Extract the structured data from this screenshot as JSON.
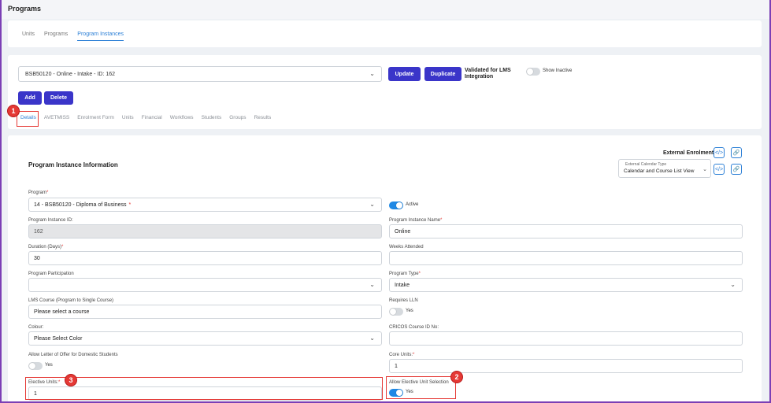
{
  "header": {
    "title": "Programs"
  },
  "subnav": [
    {
      "label": "Units",
      "active": false
    },
    {
      "label": "Programs",
      "active": false
    },
    {
      "label": "Program Instances",
      "active": true
    }
  ],
  "instance_select": {
    "value": "BSB50120 - Online - Intake - ID: 162"
  },
  "toolbar": {
    "update_label": "Update",
    "duplicate_label": "Duplicate",
    "validated_label": "Validated for LMS Integration",
    "show_inactive_label": "Show Inactive",
    "add_label": "Add",
    "delete_label": "Delete"
  },
  "tabs": [
    {
      "label": "Details",
      "active": true
    },
    {
      "label": "AVETMISS",
      "active": false
    },
    {
      "label": "Enrolment Form",
      "active": false
    },
    {
      "label": "Units",
      "active": false
    },
    {
      "label": "Financial",
      "active": false
    },
    {
      "label": "Workflows",
      "active": false
    },
    {
      "label": "Students",
      "active": false
    },
    {
      "label": "Groups",
      "active": false
    },
    {
      "label": "Results",
      "active": false
    }
  ],
  "section": {
    "title": "Program Instance Information",
    "external_enrolment_label": "External Enrolment",
    "calendar_type_caption": "External Calendar Type",
    "calendar_type_value": "Calendar and Course List View"
  },
  "form": {
    "program_label": "Program",
    "program_value": "14 - BSB50120 - Diploma of Business",
    "active_label": "Active",
    "instance_id_label": "Program Instance ID:",
    "instance_id_value": "162",
    "instance_name_label": "Program Instance Name",
    "instance_name_value": "Online",
    "duration_label": "Duration (Days)",
    "duration_value": "30",
    "weeks_attended_label": "Weeks Attended",
    "weeks_attended_value": "",
    "participation_label": "Program Participation",
    "participation_value": "",
    "program_type_label": "Program Type",
    "program_type_value": "Intake",
    "lms_course_label": "LMS Course (Program to Single Course)",
    "lms_course_value": "Please select a course",
    "requires_lln_label": "Requires LLN",
    "requires_lln_toggle": "Yes",
    "colour_label": "Colour:",
    "colour_value": "Please Select Color",
    "cricos_label": "CRICOS Course ID No:",
    "cricos_value": "",
    "letter_of_offer_label": "Allow Letter of Offer for Domestic Students",
    "letter_of_offer_toggle": "Yes",
    "core_units_label": "Core Units:",
    "core_units_value": "1",
    "elective_units_label": "Elective Units:",
    "elective_units_value": "1",
    "allow_elective_label": "Allow Elective Unit Selection",
    "allow_elective_toggle": "Yes"
  },
  "annotations": {
    "badge1": "1",
    "badge2": "2",
    "badge3": "3"
  },
  "colors": {
    "primary_button": "#3a35c9",
    "active_link": "#2b7fd6",
    "annotation_red": "#e53935",
    "toggle_on": "#1e88e5"
  },
  "icons": [
    "chevron-down-icon",
    "code-icon",
    "link-icon"
  ]
}
